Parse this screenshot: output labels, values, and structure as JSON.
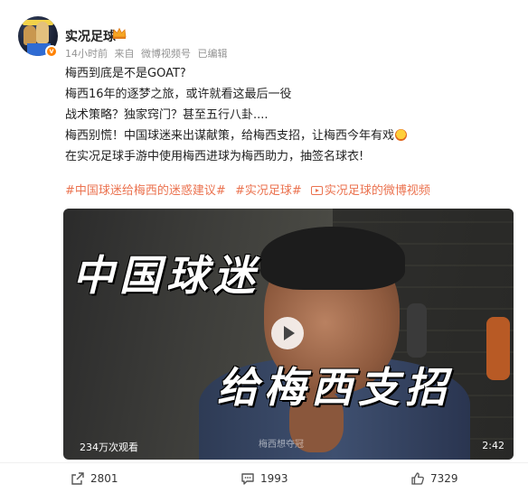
{
  "post": {
    "author": {
      "name": "实况足球",
      "avatar_icon": "team-photo-avatar",
      "badge_icon": "verified-badge-icon",
      "crown_icon": "vip-crown-icon"
    },
    "meta": {
      "time": "14小时前",
      "source_prefix": "来自",
      "source": "微博视频号",
      "edited": "已编辑"
    },
    "lines": [
      "梅西到底是不是GOAT?",
      "梅西16年的逐梦之旅，或许就看这最后一役",
      "战术策略？独家窍门？甚至五行八卦....",
      "梅西别慌！中国球迷来出谋献策，给梅西支招，让梅西今年有戏",
      "在实况足球手游中使用梅西进球为梅西助力，抽签名球衣!"
    ],
    "tags": {
      "tag1": "#中国球迷给梅西的迷惑建议#",
      "tag2": "#实况足球#",
      "tag3": "实况足球的微博视频"
    },
    "video": {
      "caption_top": "中国球迷",
      "caption_bottom": "给梅西支招",
      "watermark": "梅西想夺冠",
      "views": "234万次观看",
      "duration": "2:42"
    },
    "actions": {
      "repost": "2801",
      "comment": "1993",
      "like": "7329"
    }
  },
  "colors": {
    "tag": "#eb7350",
    "meta": "#939393",
    "text": "#222222"
  }
}
